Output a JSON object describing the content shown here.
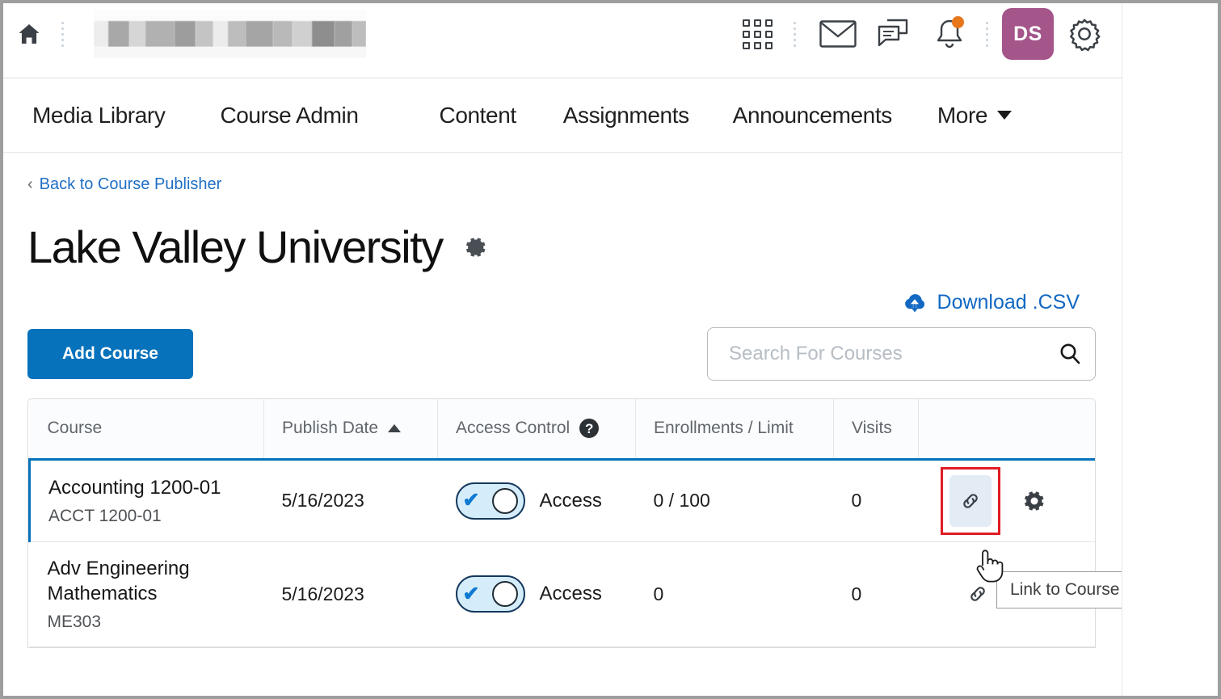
{
  "header": {
    "home_icon": "home-icon",
    "course_title_blurred": "",
    "icons": [
      {
        "name": "waffle-menu-icon",
        "label": "Apps"
      },
      {
        "name": "email-icon",
        "label": "Email"
      },
      {
        "name": "message-icon",
        "label": "Messages"
      },
      {
        "name": "notifications-bell-icon",
        "label": "Notifications",
        "badge": true
      }
    ],
    "avatar": {
      "initials": "DS",
      "color": "#a4558a"
    },
    "settings_icon": "gear-icon"
  },
  "nav": {
    "items": [
      {
        "label": "Media Library"
      },
      {
        "label": "Course Admin"
      },
      {
        "label": "Content"
      },
      {
        "label": "Assignments"
      },
      {
        "label": "Announcements"
      },
      {
        "label": "More"
      }
    ]
  },
  "breadcrumb": {
    "caret": "‹",
    "link": "Back to Course Publisher"
  },
  "page": {
    "title": "Lake Valley University",
    "title_gear": "gear-icon"
  },
  "toolbar": {
    "csv_label": "Download .CSV",
    "csv_icon": "cloud-download-icon",
    "add_course_label": "Add Course"
  },
  "search": {
    "value": "",
    "placeholder": "Search For Courses",
    "icon": "search-icon"
  },
  "table": {
    "columns": [
      {
        "key": "course",
        "label": "Course",
        "sort": null
      },
      {
        "key": "publish_date",
        "label": "Publish Date",
        "sort": "asc"
      },
      {
        "key": "access_control",
        "label": "Access Control",
        "help": "?"
      },
      {
        "key": "enrollments",
        "label": "Enrollments / Limit"
      },
      {
        "key": "visits",
        "label": "Visits"
      },
      {
        "key": "actions",
        "label": ""
      }
    ],
    "rows": [
      {
        "course_name": "Accounting 1200-01",
        "course_code": "ACCT 1200-01",
        "publish_date": "5/16/2023",
        "access_enabled": true,
        "access_label": "Access",
        "enrollments": "0 / 100",
        "visits": "0",
        "selected": true,
        "link_highlighted": true
      },
      {
        "course_name": "Adv Engineering Mathematics",
        "course_code": "ME303",
        "publish_date": "5/16/2023",
        "access_enabled": true,
        "access_label": "Access",
        "enrollments": "0",
        "visits": "0",
        "selected": false,
        "link_highlighted": false
      }
    ]
  },
  "tooltip": {
    "text": "Link to Course"
  },
  "colors": {
    "accent_blue": "#0672bc",
    "link_blue": "#1268c3",
    "avatar_magenta": "#a4558a",
    "notification_orange": "#e8761a",
    "highlight_red": "#e01b24",
    "toggle_track": "#d5edfb"
  }
}
